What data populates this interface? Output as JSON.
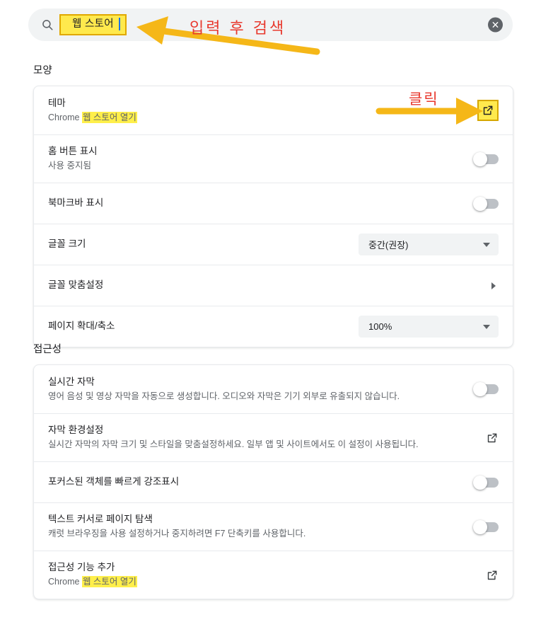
{
  "search": {
    "icon": "search-icon",
    "value": "웹 스토어",
    "clear_icon": "close-icon"
  },
  "sections": [
    {
      "id": "appearance",
      "title": "모양",
      "rows": [
        {
          "name": "theme",
          "title": "테마",
          "sub_prefix": "Chrome ",
          "sub_highlight": "웹 스토어 열기",
          "control": "external-link-highlighted"
        },
        {
          "name": "show-home-button",
          "title": "홈 버튼 표시",
          "sub": "사용 중지됨",
          "control": "toggle-off"
        },
        {
          "name": "show-bookmarks-bar",
          "title": "북마크바 표시",
          "control": "toggle-off"
        },
        {
          "name": "font-size",
          "title": "글꼴 크기",
          "control": "select",
          "value": "중간(권장)"
        },
        {
          "name": "customize-fonts",
          "title": "글꼴 맞춤설정",
          "control": "chevron"
        },
        {
          "name": "page-zoom",
          "title": "페이지 확대/축소",
          "control": "select",
          "value": "100%"
        }
      ]
    },
    {
      "id": "accessibility",
      "title": "접근성",
      "rows": [
        {
          "name": "live-caption",
          "title": "실시간 자막",
          "sub": "영어 음성 및 영상 자막을 자동으로 생성합니다. 오디오와 자막은 기기 외부로 유출되지 않습니다.",
          "control": "toggle-off"
        },
        {
          "name": "caption-preferences",
          "title": "자막 환경설정",
          "sub": "실시간 자막의 자막 크기 및 스타일을 맞춤설정하세요. 일부 앱 및 사이트에서도 이 설정이 사용됩니다.",
          "control": "external-link"
        },
        {
          "name": "quick-highlight-focused",
          "title": "포커스된 객체를 빠르게 강조표시",
          "control": "toggle-off"
        },
        {
          "name": "caret-browsing",
          "title": "텍스트 커서로 페이지 탐색",
          "sub": "캐럿 브라우징을 사용 설정하거나 중지하려면 F7 단축키를 사용합니다.",
          "control": "toggle-off"
        },
        {
          "name": "add-accessibility-features",
          "title": "접근성 기능 추가",
          "sub_prefix": "Chrome ",
          "sub_highlight": "웹 스토어 열기",
          "control": "external-link"
        }
      ]
    }
  ],
  "annotations": {
    "search_note": "입력 후 검색",
    "click_note": "클릭",
    "arrow_color": "#f5b718",
    "note_color": "#e8392e",
    "highlight_color": "#ffef4a"
  }
}
